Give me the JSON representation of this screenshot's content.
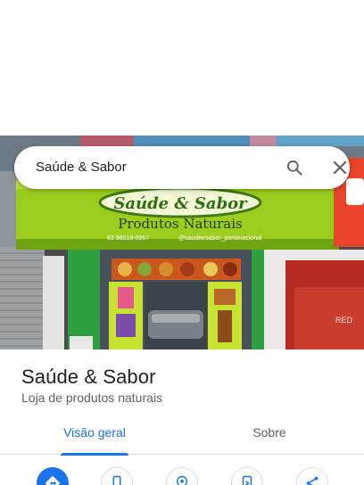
{
  "search": {
    "query": "Saúde & Sabor"
  },
  "photo": {
    "sign_title": "Saúde & Sabor",
    "sign_subtitle": "Produtos Naturais",
    "sign_phone": "63 98518-0867",
    "sign_instagram": "@saudeesabor_portonacional"
  },
  "place": {
    "name": "Saúde & Sabor",
    "category": "Loja de produtos naturais"
  },
  "tabs": [
    {
      "label": "Visão geral",
      "selected": true
    },
    {
      "label": "Sobre",
      "selected": false
    }
  ],
  "actions": [
    {
      "icon": "directions-icon"
    },
    {
      "icon": "phone-icon"
    },
    {
      "icon": "location-icon"
    },
    {
      "icon": "send-to-phone-icon"
    },
    {
      "icon": "share-icon"
    }
  ],
  "colors": {
    "accent": "#1a73e8",
    "sign_green": "#9ccc1e",
    "text_primary": "#202124",
    "text_secondary": "#5f6368"
  }
}
